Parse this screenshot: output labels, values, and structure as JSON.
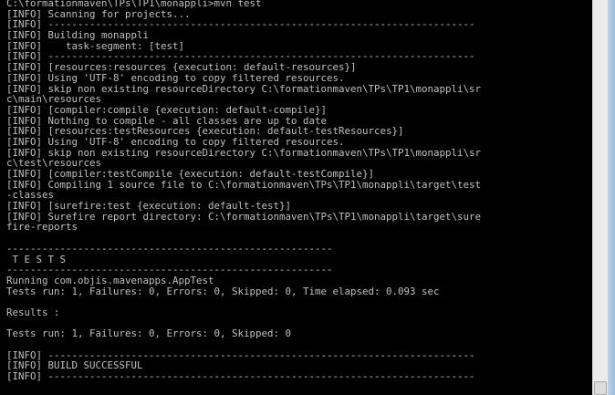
{
  "console": {
    "lines": [
      "C:\\formationmaven\\TPs\\TP1\\monappli>mvn test",
      "[INFO] Scanning for projects...",
      "[INFO] ------------------------------------------------------------------------",
      "[INFO] Building monappli",
      "[INFO]    task-segment: [test]",
      "[INFO] ------------------------------------------------------------------------",
      "[INFO] [resources:resources {execution: default-resources}]",
      "[INFO] Using 'UTF-8' encoding to copy filtered resources.",
      "[INFO] skip non existing resourceDirectory C:\\formationmaven\\TPs\\TP1\\monappli\\sr",
      "c\\main\\resources",
      "[INFO] [compiler:compile {execution: default-compile}]",
      "[INFO] Nothing to compile - all classes are up to date",
      "[INFO] [resources:testResources {execution: default-testResources}]",
      "[INFO] Using 'UTF-8' encoding to copy filtered resources.",
      "[INFO] skip non existing resourceDirectory C:\\formationmaven\\TPs\\TP1\\monappli\\sr",
      "c\\test\\resources",
      "[INFO] [compiler:testCompile {execution: default-testCompile}]",
      "[INFO] Compiling 1 source file to C:\\formationmaven\\TPs\\TP1\\monappli\\target\\test",
      "-classes",
      "[INFO] [surefire:test {execution: default-test}]",
      "[INFO] Surefire report directory: C:\\formationmaven\\TPs\\TP1\\monappli\\target\\sure",
      "fire-reports",
      "",
      "-------------------------------------------------------",
      " T E S T S",
      "-------------------------------------------------------",
      "Running com.objis.mavenapps.AppTest",
      "Tests run: 1, Failures: 0, Errors: 0, Skipped: 0, Time elapsed: 0.093 sec",
      "",
      "Results :",
      "",
      "Tests run: 1, Failures: 0, Errors: 0, Skipped: 0",
      "",
      "[INFO] ------------------------------------------------------------------------",
      "[INFO] BUILD SUCCESSFUL",
      "[INFO] ------------------------------------------------------------------------"
    ],
    "text_color": "#c0c0c0",
    "background_color": "#000000"
  },
  "scrollbar": {
    "position_fraction": 1.0
  }
}
